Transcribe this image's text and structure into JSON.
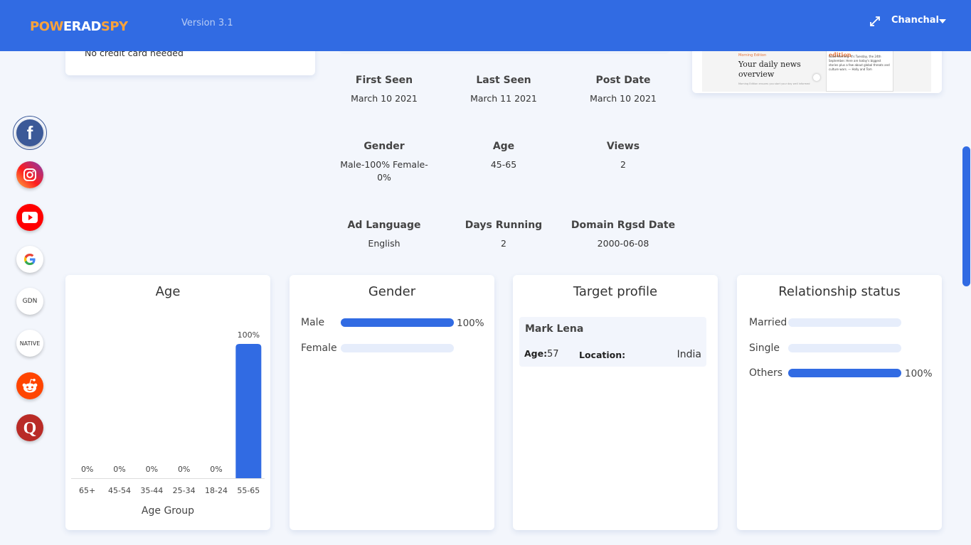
{
  "header": {
    "logo": {
      "part1": "POW",
      "part2": "ER",
      "part3": "AD",
      "part4": "SPY"
    },
    "version": "Version 3.1",
    "user_name": "Chanchal"
  },
  "promo": {
    "text": "No credit card needed"
  },
  "preview": {
    "tag": "Morning Edition",
    "headline": "Your daily news overview",
    "sub": "Morning Edition ensures you start your day well informed",
    "phone_brand": "inkl",
    "phone_edition": "morning edition",
    "phone_text": "Good Morning. It's Tuesday, the 24th September. Here are today's biggest stories plus a few about global threats and culture wars. — Holly and Tom"
  },
  "stats": [
    {
      "label": "First Seen",
      "value": "March 10 2021"
    },
    {
      "label": "Last Seen",
      "value": "March 11 2021"
    },
    {
      "label": "Post Date",
      "value": "March 10 2021"
    },
    {
      "label": "Gender",
      "value": "Male-100% Female-0%"
    },
    {
      "label": "Age",
      "value": "45-65"
    },
    {
      "label": "Views",
      "value": "2"
    },
    {
      "label": "Ad Language",
      "value": "English"
    },
    {
      "label": "Days Running",
      "value": "2"
    },
    {
      "label": "Domain Rgsd Date",
      "value": "2000-06-08"
    }
  ],
  "sidebar": {
    "items": [
      {
        "name": "facebook",
        "label": "f",
        "color": "#3b5998"
      },
      {
        "name": "instagram",
        "label": "",
        "color": "#d6249f"
      },
      {
        "name": "youtube",
        "label": "",
        "color": "#ff0000"
      },
      {
        "name": "google",
        "label": "G",
        "color": "#4285f4"
      },
      {
        "name": "gdn",
        "label": "GDN",
        "color": "#ffffff"
      },
      {
        "name": "native",
        "label": "NATIVE",
        "color": "#ffffff"
      },
      {
        "name": "reddit",
        "label": "",
        "color": "#ff4500"
      },
      {
        "name": "quora",
        "label": "Q",
        "color": "#b92b27"
      }
    ]
  },
  "age_card": {
    "title": "Age",
    "chart_data": {
      "type": "bar",
      "categories": [
        "65+",
        "45-54",
        "35-44",
        "25-34",
        "18-24",
        "55-65"
      ],
      "values": [
        0,
        0,
        0,
        0,
        0,
        100
      ],
      "data_labels": [
        "0%",
        "0%",
        "0%",
        "0%",
        "0%",
        "100%"
      ],
      "xlabel": "Age Group",
      "ylim": [
        0,
        100
      ],
      "color": "#316be3"
    }
  },
  "gender_card": {
    "title": "Gender",
    "rows": [
      {
        "label": "Male",
        "value": 100,
        "pct": "100%"
      },
      {
        "label": "Female",
        "value": 0,
        "pct": ""
      }
    ]
  },
  "target_card": {
    "title": "Target profile",
    "name": "Mark Lena",
    "age_label": "Age:",
    "age_value": "57",
    "location_label": "Location:",
    "location_value": "India"
  },
  "relationship_card": {
    "title": "Relationship status",
    "rows": [
      {
        "label": "Married",
        "value": 0,
        "pct": ""
      },
      {
        "label": "Single",
        "value": 0,
        "pct": ""
      },
      {
        "label": "Others",
        "value": 100,
        "pct": "100%"
      }
    ]
  },
  "colors": {
    "accent": "#316be3",
    "logo_orange": "#f9a33c"
  }
}
